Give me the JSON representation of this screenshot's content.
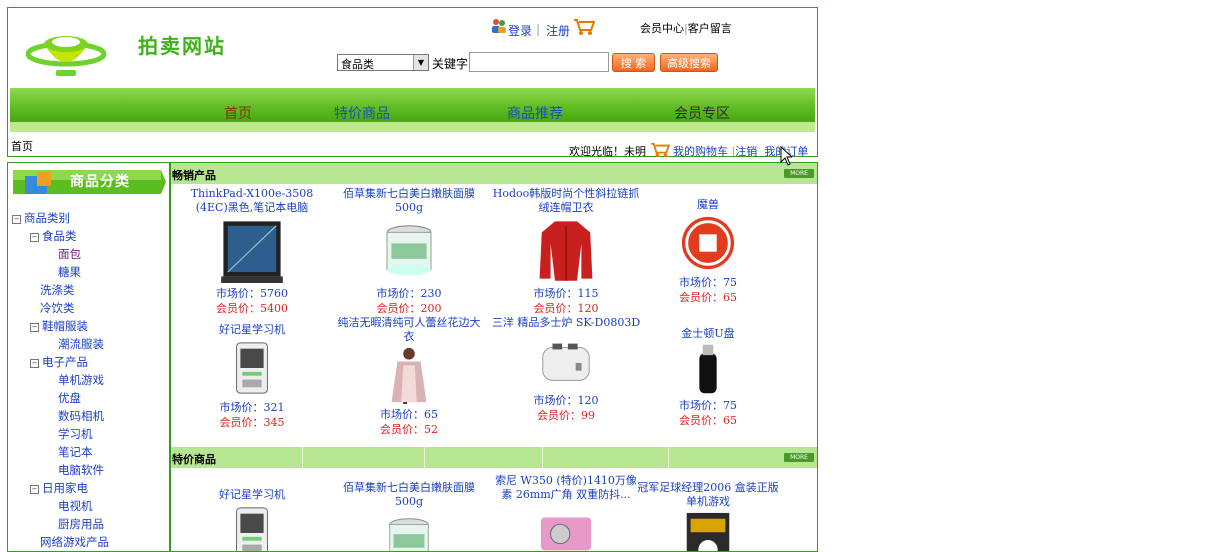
{
  "header": {
    "site_title": "拍卖网站",
    "login": "登录",
    "register": "注册",
    "separator": "|",
    "member_center": "会员中心",
    "guestbook": "客户留言",
    "category_value": "食品类",
    "keyword_label": "关键字",
    "keyword_value": "",
    "search_btn": "搜 索",
    "advanced_btn": "高级搜索"
  },
  "nav": [
    "首页",
    "特价商品",
    "商品推荐",
    "会员专区"
  ],
  "breadcrumb": "首页",
  "welcome": {
    "greeting": "欢迎光临！",
    "user": "未明",
    "cart": "我的购物车",
    "logout": "注销",
    "orders": "我的订单"
  },
  "sidebar": {
    "banner": "商品分类",
    "tree": [
      {
        "label": "商品类别",
        "level": 0,
        "box": "−"
      },
      {
        "label": "食品类",
        "level": 1,
        "box": "−"
      },
      {
        "label": "面包",
        "level": 2,
        "visited": true
      },
      {
        "label": "糖果",
        "level": 2
      },
      {
        "label": "洗涤类",
        "level": 1
      },
      {
        "label": "冷饮类",
        "level": 1
      },
      {
        "label": "鞋帽服装",
        "level": 1,
        "box": "−"
      },
      {
        "label": "潮流服装",
        "level": 2
      },
      {
        "label": "电子产品",
        "level": 1,
        "box": "−"
      },
      {
        "label": "单机游戏",
        "level": 2
      },
      {
        "label": "优盘",
        "level": 2
      },
      {
        "label": "数码相机",
        "level": 2
      },
      {
        "label": "学习机",
        "level": 2
      },
      {
        "label": "笔记本",
        "level": 2
      },
      {
        "label": "电脑软件",
        "level": 2
      },
      {
        "label": "日用家电",
        "level": 1,
        "box": "−"
      },
      {
        "label": "电视机",
        "level": 2
      },
      {
        "label": "厨房用品",
        "level": 2
      },
      {
        "label": "网络游戏产品",
        "level": 1
      }
    ]
  },
  "hot": {
    "title": "畅销产品",
    "more": "MORE",
    "products": [
      {
        "name": "ThinkPad-X100e-3508 (4EC)黑色,笔记本电脑",
        "market": "市场价：",
        "market_price": "5760",
        "member": "会员价：",
        "member_price": "5400",
        "icon": "laptop-icon"
      },
      {
        "name": "佰草集新七白美白嫩肤面膜500g",
        "market": "市场价：",
        "market_price": "230",
        "member": "会员价：",
        "member_price": "200",
        "icon": "jar-icon"
      },
      {
        "name": "Hodoo韩版时尚个性斜拉链抓绒连帽卫衣",
        "market": "市场价：",
        "market_price": "115",
        "member": "会员价：",
        "member_price": "120",
        "icon": "jacket-icon"
      },
      {
        "name": "魔兽",
        "market": "市场价：",
        "market_price": "75",
        "member": "会员价：",
        "member_price": "65",
        "icon": "stop-icon"
      },
      {
        "name": "好记星学习机",
        "market": "市场价：",
        "market_price": "321",
        "member": "会员价：",
        "member_price": "345",
        "icon": "device-icon"
      },
      {
        "name": "纯洁无暇清纯可人蕾丝花边大衣",
        "market": "市场价：",
        "market_price": "65",
        "member": "会员价：",
        "member_price": "52",
        "icon": "coat-icon"
      },
      {
        "name": "三洋 精品多士炉 SK-D0803D",
        "market": "市场价：",
        "market_price": "120",
        "member": "会员价：",
        "member_price": "99",
        "icon": "toaster-icon"
      },
      {
        "name": "金士顿U盘",
        "market": "市场价：",
        "market_price": "75",
        "member": "会员价：",
        "member_price": "65",
        "icon": "usb-icon"
      }
    ]
  },
  "special": {
    "title": "特价商品",
    "more": "MORE",
    "products": [
      {
        "name": "好记星学习机",
        "icon": "device-icon"
      },
      {
        "name": "佰草集新七白美白嫩肤面膜500g",
        "icon": "jar-icon"
      },
      {
        "name": "索尼 W350 (特价)1410万像素 26mm广角 双重防抖...",
        "icon": "camera-icon"
      },
      {
        "name": "冠军足球经理2006 盒装正版单机游戏",
        "icon": "game-box-icon"
      }
    ]
  },
  "colors": {
    "accent_green": "#5dbb22",
    "link_blue": "#1b3fc4",
    "price_red": "#e02020"
  }
}
